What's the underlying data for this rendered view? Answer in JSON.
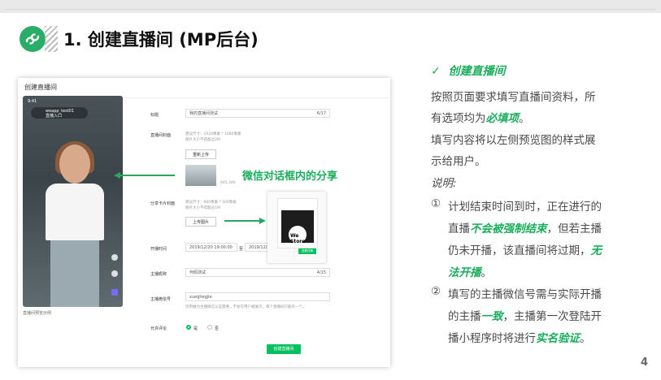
{
  "slide": {
    "title": "1. 创建直播间 (MP后台)",
    "page_number": "4"
  },
  "screenshot": {
    "window_title": "创建直播间",
    "phone": {
      "status_time": "9:41",
      "account_name": "weapp_test01",
      "account_sub": "直播入口",
      "caption": "直播间预览示例"
    },
    "form": {
      "title_label": "标题",
      "title_value": "我的直播间测试",
      "title_count": "6/17",
      "cover_label": "直播间封面",
      "cover_hint_1": "建议尺寸：1920像素 * 1080像素",
      "cover_hint_2": "图片大小不得超过2M",
      "cover_button": "重新上传",
      "cover_size": "645.34K",
      "share_label": "分享卡片封面",
      "share_hint_1": "建议尺寸：800像素 * 500像素",
      "share_hint_2": "图片大小不得超过1M",
      "share_button": "上传图片",
      "time_label": "开播时间",
      "time_start": "2019/12/20 19:00:00",
      "time_sep": "至",
      "time_end": "2019/12/20 21:00:00",
      "host_label": "主播昵称",
      "host_value": "何佩测试",
      "host_count": "4/15",
      "wechat_label": "主播微信号",
      "wechat_value": "xueghegjie",
      "wechat_hint": "仅用做为主播微信认证需要，不会在用户端展示，每个直播间只能有一个。",
      "review_label": "允许评论",
      "option_yes": "是",
      "option_no": "否",
      "submit": "创建直播间"
    },
    "share_card": {
      "logo_text": "We Store",
      "button": "查看详情"
    },
    "callout": "微信对话框内的分享"
  },
  "right_panel": {
    "check_mark": "✓",
    "heading": "创建直播间",
    "p1_a": "按照页面要求填写直播间资料，所",
    "p1_b": "有选项均为",
    "p1_hl": "必填项",
    "p1_end": "。",
    "p2_a": "填写内容将以左侧预览图的样式展",
    "p2_b": "示给用户。",
    "note": "说明:",
    "n1_mark": "①",
    "n1_a": "计划结束时间到时，正在进行的",
    "n1_b1": "直播",
    "n1_hl1": "不会被强制结束",
    "n1_b2": "，但若主播",
    "n1_c": "仍未开播，该直播间将过期，",
    "n1_hl2a": "无",
    "n1_hl2b": "法开播",
    "n1_end": "。",
    "n2_mark": "②",
    "n2_a": "填写的主播微信号需与实际开播",
    "n2_b1": "的主播",
    "n2_hl1": "一致",
    "n2_b2": "，主播第一次登陆开",
    "n2_c1": "播小程序时将进行",
    "n2_hl2": "实名验证",
    "n2_end": "。"
  },
  "colors": {
    "accent_green": "#1aad5b",
    "wechat_green": "#07c160",
    "logo_green": "#2aae67"
  }
}
